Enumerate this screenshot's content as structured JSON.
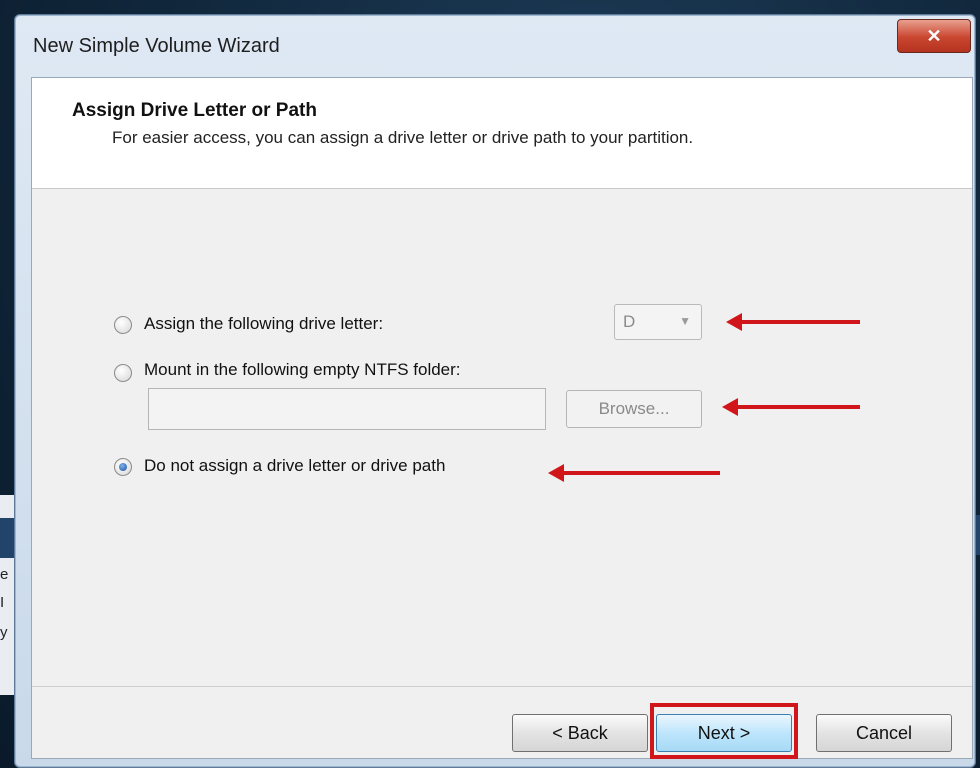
{
  "window": {
    "title": "New Simple Volume Wizard",
    "close_glyph": "✕"
  },
  "header": {
    "title": "Assign Drive Letter or Path",
    "subtitle": "For easier access, you can assign a drive letter or drive path to your partition."
  },
  "options": {
    "assign_letter": {
      "label": "Assign the following drive letter:",
      "selected": false
    },
    "mount_folder": {
      "label": "Mount in the following empty NTFS folder:",
      "selected": false
    },
    "no_assign": {
      "label": "Do not assign a drive letter or drive path",
      "selected": true
    }
  },
  "drive_letter_select": {
    "value": "D",
    "arrow_glyph": "▼"
  },
  "folder_path_input": {
    "value": ""
  },
  "browse_button": {
    "label": "Browse..."
  },
  "footer": {
    "back_label": "< Back",
    "next_label": "Next >",
    "cancel_label": "Cancel"
  },
  "annotations": {
    "color": "#d1161b"
  },
  "background_window": {
    "glyphs": [
      "e",
      "I",
      "y"
    ]
  }
}
